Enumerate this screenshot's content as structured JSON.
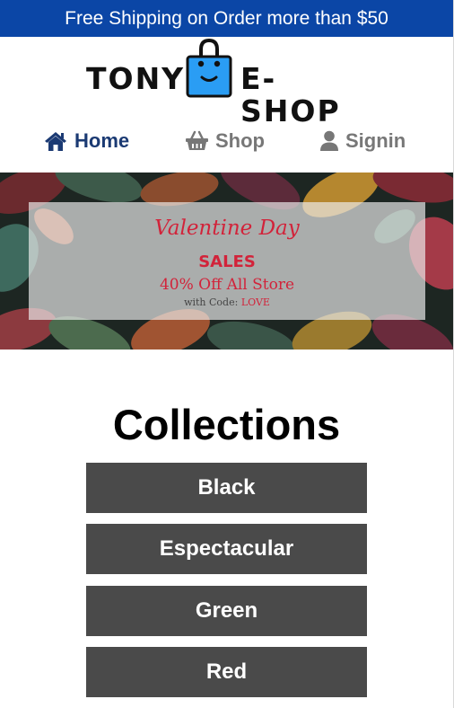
{
  "promo": {
    "text": "Free Shipping on Order more than $50"
  },
  "brand": {
    "left_text": "TONY",
    "right_text": "E-SHOP",
    "bag_color": "#2a9df4"
  },
  "nav": {
    "items": [
      {
        "label": "Home",
        "icon": "home-icon",
        "active": true
      },
      {
        "label": "Shop",
        "icon": "basket-icon",
        "active": false
      },
      {
        "label": "Signin",
        "icon": "user-icon",
        "active": false
      }
    ]
  },
  "banner": {
    "title": "Valentine Day",
    "sales": "SALES",
    "offer": "40% Off All Store",
    "code_prefix": "with Code:",
    "code": "LOVE"
  },
  "collections": {
    "title": "Collections",
    "items": [
      "Black",
      "Espectacular",
      "Green",
      "Red"
    ]
  },
  "colors": {
    "promo_bg": "#0b46a6",
    "nav_active": "#1b3a73",
    "nav_inactive": "#777777",
    "button_bg": "#4a4a4a",
    "accent_red": "#d2233a"
  }
}
